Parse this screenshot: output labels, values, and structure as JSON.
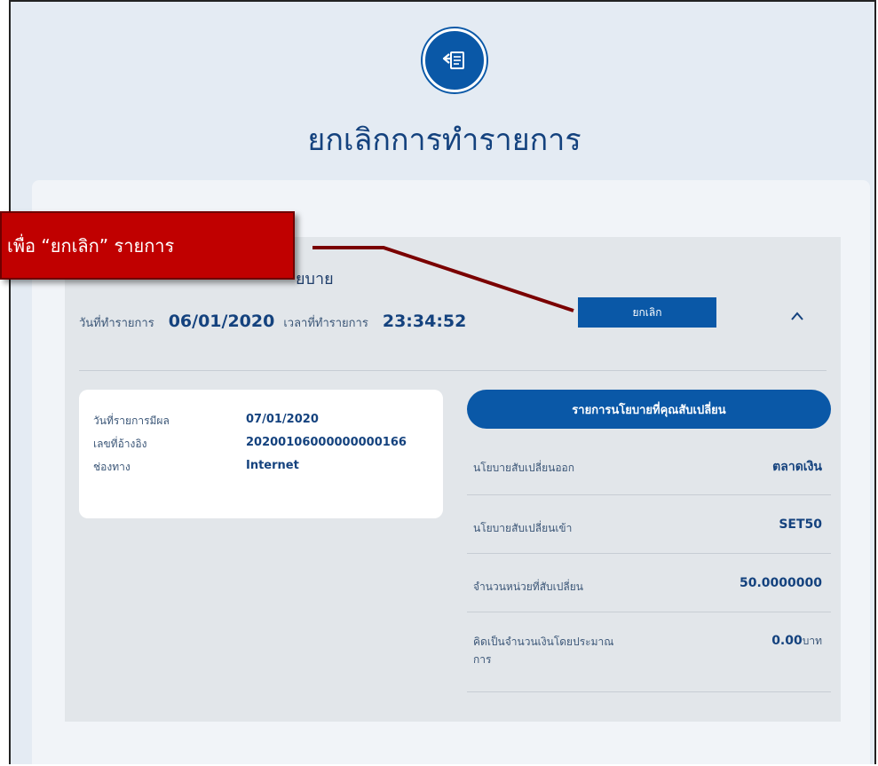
{
  "header": {
    "icon": "document-return-icon",
    "title": "ยกเลิกการทำรายการ"
  },
  "panel": {
    "title_fragment": "ยบาย",
    "date_label": "วันที่ทำรายการ",
    "date_value": "06/01/2020",
    "time_label": "เวลาที่ทำรายการ",
    "time_value": "23:34:52",
    "cancel_label": "ยกเลิก"
  },
  "info": {
    "rows": [
      {
        "label": "วันที่รายการมีผล",
        "value": "07/01/2020"
      },
      {
        "label": "เลขที่อ้างอิง",
        "value": "20200106000000000166"
      },
      {
        "label": "ช่องทาง",
        "value": "Internet"
      }
    ]
  },
  "policy": {
    "header": "รายการนโยบายที่คุณสับเปลี่ยน",
    "rows": [
      {
        "label": "นโยบายสับเปลี่ยนออก",
        "value": "ตลาดเงิน"
      },
      {
        "label": "นโยบายสับเปลี่ยนเข้า",
        "value": "SET50"
      },
      {
        "label": "จำนวนหน่วยที่สับเปลี่ยน",
        "value": "50.0000000"
      },
      {
        "label": "คิดเป็นจำนวนเงินโดยประมาณการ",
        "value": "0.00",
        "unit": "บาท"
      }
    ]
  },
  "callout": {
    "text": "เพื่อ “ยกเลิก” รายการ"
  },
  "colors": {
    "primary": "#0a58a7",
    "callout": "#c00000",
    "title": "#14427e"
  }
}
